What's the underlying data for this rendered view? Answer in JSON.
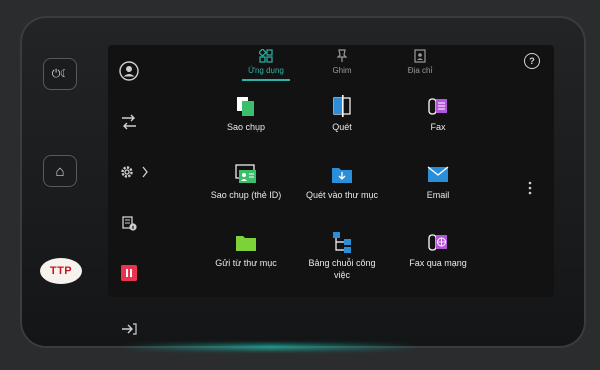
{
  "hardware": {
    "power_label": "⏻☾",
    "home_label": "⌂"
  },
  "logo_text": "TTP",
  "tabs": [
    {
      "label": "Ứng dụng",
      "icon": "apps-grid-icon",
      "active": true
    },
    {
      "label": "Ghim",
      "icon": "pin-icon",
      "active": false
    },
    {
      "label": "Địa chỉ",
      "icon": "address-book-icon",
      "active": false
    }
  ],
  "help_label": "?",
  "apps": [
    {
      "label": "Sao chụp",
      "icon": "copy-icon"
    },
    {
      "label": "Quét",
      "icon": "scan-icon"
    },
    {
      "label": "Fax",
      "icon": "fax-icon"
    },
    {
      "label": "Sao chụp (thẻ ID)",
      "icon": "id-card-copy-icon"
    },
    {
      "label": "Quét vào thư mục",
      "icon": "scan-to-folder-icon"
    },
    {
      "label": "Email",
      "icon": "email-icon"
    },
    {
      "label": "Gửi từ thư mục",
      "icon": "send-from-folder-icon"
    },
    {
      "label": "Bảng chuỗi công việc",
      "icon": "workflow-icon"
    },
    {
      "label": "Fax qua mạng",
      "icon": "internet-fax-icon"
    }
  ],
  "colors": {
    "accent": "#2bb5a9",
    "stop_red": "#e8344e"
  }
}
